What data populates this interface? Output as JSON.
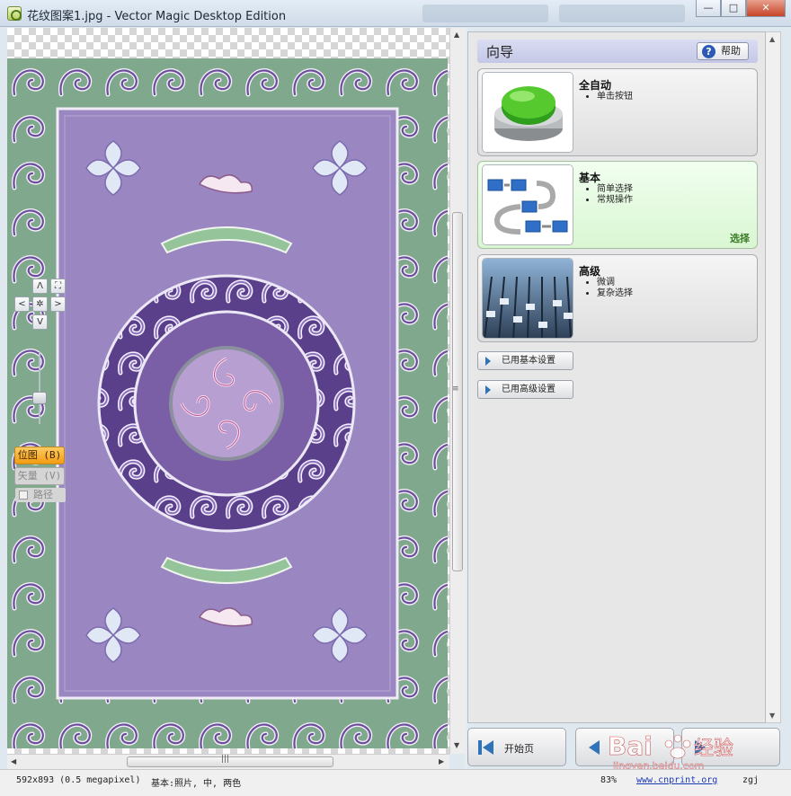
{
  "window": {
    "title": "花纹图案1.jpg - Vector Magic Desktop Edition",
    "controls": {
      "minimize": "—",
      "maximize": "□",
      "close": "✕"
    }
  },
  "canvas": {
    "view_modes": {
      "bitmap": "位图 (B)",
      "vector": "矢量 (V)",
      "path": "路径"
    },
    "nav": {
      "up": "Λ",
      "down": "V",
      "left": "<",
      "right": ">",
      "center": "✲",
      "fit": "⛶"
    }
  },
  "wizard": {
    "title": "向导",
    "help_label": "帮助",
    "options": [
      {
        "title": "全自动",
        "bullets": [
          "单击按钮"
        ]
      },
      {
        "title": "基本",
        "bullets": [
          "简单选择",
          "常规操作"
        ],
        "selected_label": "选择"
      },
      {
        "title": "高级",
        "bullets": [
          "微调",
          "复杂选择"
        ]
      }
    ],
    "buttons": {
      "basic_settings": "已用基本设置",
      "advanced_settings": "已用高级设置"
    },
    "bottom": {
      "start_page": "开始页"
    }
  },
  "status": {
    "dimensions": "592x893 (0.5 megapixel)",
    "mode": "基本:照片, 中, 两色",
    "zoom": "83%",
    "link": "www.cnprint.org",
    "user": "zgj"
  },
  "watermark": {
    "brand": "Bai",
    "brand2": "经验",
    "url": "jingyan.baidu.com"
  },
  "colors": {
    "carpet_border": "#7fa88d",
    "carpet_field": "#9a86c0",
    "carpet_dark": "#5a3f8a",
    "accent_orange": "#f39b12",
    "selected_green": "#3a7b25"
  }
}
